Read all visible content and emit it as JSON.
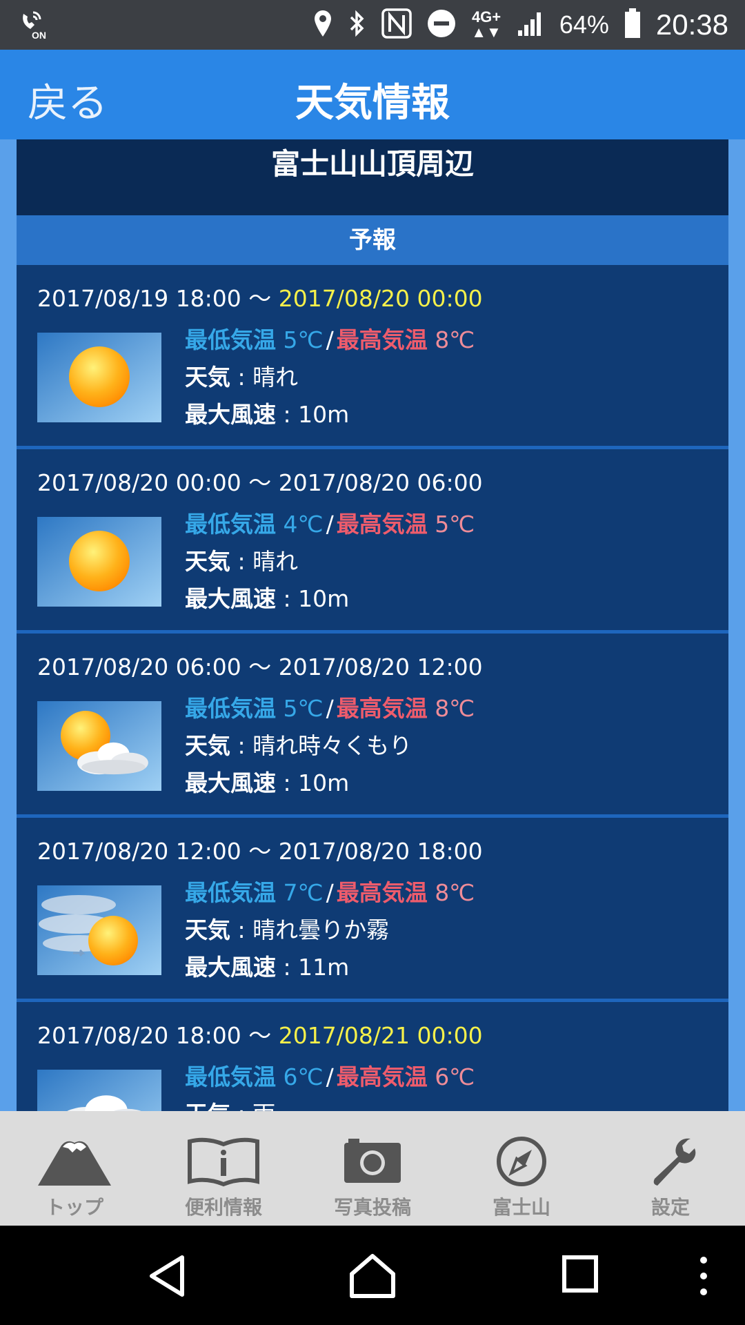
{
  "status_bar": {
    "battery": "64%",
    "time": "20:38",
    "network": "4G+",
    "icons": [
      "wifi-calling-on-icon",
      "location-icon",
      "bluetooth-icon",
      "nfc-icon",
      "do-not-disturb-icon",
      "signal-icon",
      "battery-icon"
    ]
  },
  "header": {
    "back_label": "戻る",
    "title": "天気情報"
  },
  "location": "富士山山頂周辺",
  "forecast_label": "予報",
  "labels": {
    "min_temp": "最低気温",
    "max_temp": "最高気温",
    "weather": "天気",
    "max_wind": "最大風速",
    "colon": ":",
    "slash": "/",
    "tilde": "〜"
  },
  "entries": [
    {
      "start": "2017/08/19 18:00",
      "end": "2017/08/20 00:00",
      "end_highlight": true,
      "min": "5℃",
      "max": "8℃",
      "weather": "晴れ",
      "wind": "10m",
      "icon": "sunny-icon"
    },
    {
      "start": "2017/08/20 00:00",
      "end": "2017/08/20 06:00",
      "end_highlight": false,
      "min": "4℃",
      "max": "5℃",
      "weather": "晴れ",
      "wind": "10m",
      "icon": "sunny-icon"
    },
    {
      "start": "2017/08/20 06:00",
      "end": "2017/08/20 12:00",
      "end_highlight": false,
      "min": "5℃",
      "max": "8℃",
      "weather": "晴れ時々くもり",
      "wind": "10m",
      "icon": "sun-cloud-icon"
    },
    {
      "start": "2017/08/20 12:00",
      "end": "2017/08/20 18:00",
      "end_highlight": false,
      "min": "7℃",
      "max": "8℃",
      "weather": "晴れ曇りか霧",
      "wind": "11m",
      "icon": "sun-fog-icon"
    },
    {
      "start": "2017/08/20 18:00",
      "end": "2017/08/21 00:00",
      "end_highlight": true,
      "min": "6℃",
      "max": "6℃",
      "weather": "雨",
      "wind": "",
      "icon": "cloud-icon"
    }
  ],
  "tabs": [
    {
      "label": "トップ",
      "icon": "mountain-icon"
    },
    {
      "label": "便利情報",
      "icon": "book-info-icon"
    },
    {
      "label": "写真投稿",
      "icon": "camera-icon"
    },
    {
      "label": "富士山",
      "icon": "compass-icon"
    },
    {
      "label": "設定",
      "icon": "wrench-icon"
    }
  ],
  "colors": {
    "header": "#2a86e6",
    "panel": "#0e3a73",
    "min_temp": "#36a8e8",
    "max_temp": "#ee5c6c",
    "highlight": "#f6f04a",
    "tab_inactive": "#8c8c8c"
  }
}
